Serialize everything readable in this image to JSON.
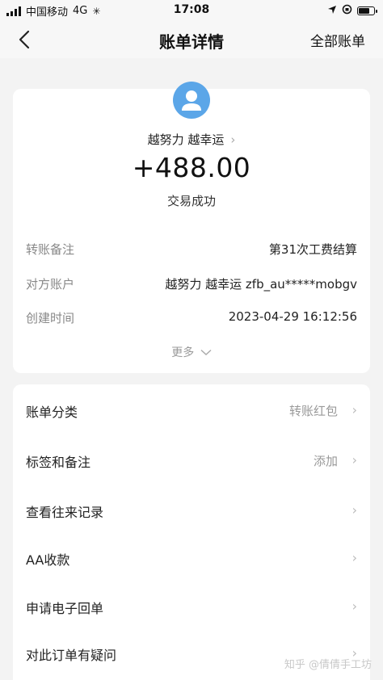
{
  "status_bar": {
    "carrier": "中国移动",
    "network": "4G",
    "time": "17:08",
    "battery_level": 0.75
  },
  "nav": {
    "title": "账单详情",
    "right_action": "全部账单"
  },
  "summary": {
    "payee": "越努力 越幸运",
    "amount": "+488.00",
    "status": "交易成功",
    "details": [
      {
        "key": "转账备注",
        "value": "第31次工费结算"
      },
      {
        "key": "对方账户",
        "value": "越努力 越幸运 zfb_au*****mobgv"
      },
      {
        "key": "创建时间",
        "value": "2023-04-29 16:12:56"
      }
    ],
    "more": "更多"
  },
  "menu": [
    {
      "label": "账单分类",
      "value": "转账红包"
    },
    {
      "label": "标签和备注",
      "value": "添加"
    },
    {
      "label": "查看往来记录",
      "value": ""
    },
    {
      "label": "AA收款",
      "value": ""
    },
    {
      "label": "申请电子回单",
      "value": ""
    },
    {
      "label": "对此订单有疑问",
      "value": ""
    }
  ],
  "watermark": "知乎 @倩倩手工坊"
}
